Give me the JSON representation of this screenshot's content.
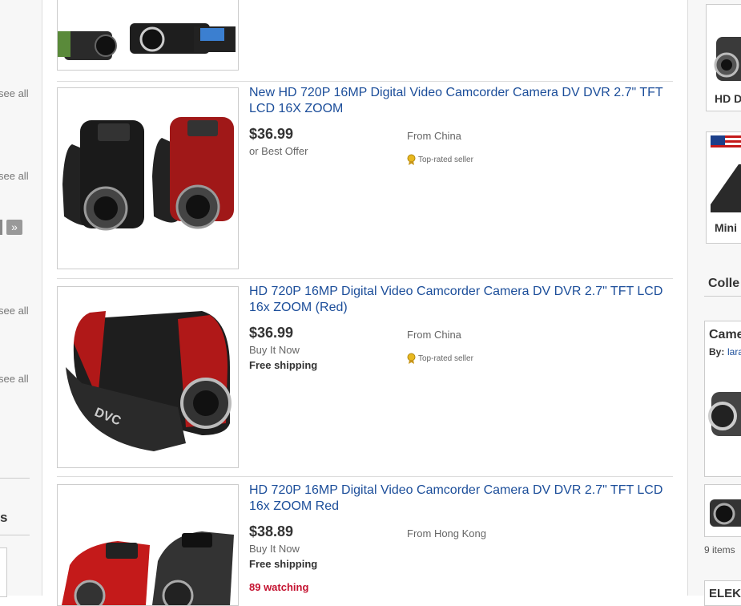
{
  "left_sidebar": {
    "see_all": [
      "see all",
      "see all",
      "see all",
      "see all"
    ],
    "next_page_glyph": "»",
    "section_heading": "s"
  },
  "listings": [
    {
      "title": "New HD 720P 16MP Digital Video Camcorder Camera DV DVR 2.7\" TFT LCD 16X ZOOM",
      "price": "$36.99",
      "format": "or Best Offer",
      "shipping": "",
      "watching": "",
      "location": "From China",
      "seller_badge": "Top-rated seller",
      "colors": [
        "#1a1a1a",
        "#a01818"
      ]
    },
    {
      "title": "HD 720P 16MP Digital Video Camcorder Camera DV DVR 2.7\" TFT LCD 16x ZOOM (Red)",
      "price": "$36.99",
      "format": "Buy It Now",
      "shipping": "Free shipping",
      "watching": "",
      "location": "From China",
      "seller_badge": "Top-rated seller",
      "colors": [
        "#b01818"
      ]
    },
    {
      "title": "HD 720P 16MP Digital Video Camcorder Camera DV DVR 2.7\" TFT LCD 16x ZOOM Red",
      "price": "$38.89",
      "format": "Buy It Now",
      "shipping": "Free shipping",
      "watching": "89 watching",
      "location": "From Hong Kong",
      "seller_badge": "",
      "colors": [
        "#c41a1a",
        "#333333"
      ]
    }
  ],
  "right_sidebar": {
    "card1_title": "HD D",
    "card2_title": "Mini",
    "collections_heading": "Colle",
    "collection_title": "Came",
    "collection_by_label": "By:",
    "collection_by_user": "lara",
    "collection_count": "9 items",
    "next_heading": "ELEK"
  }
}
